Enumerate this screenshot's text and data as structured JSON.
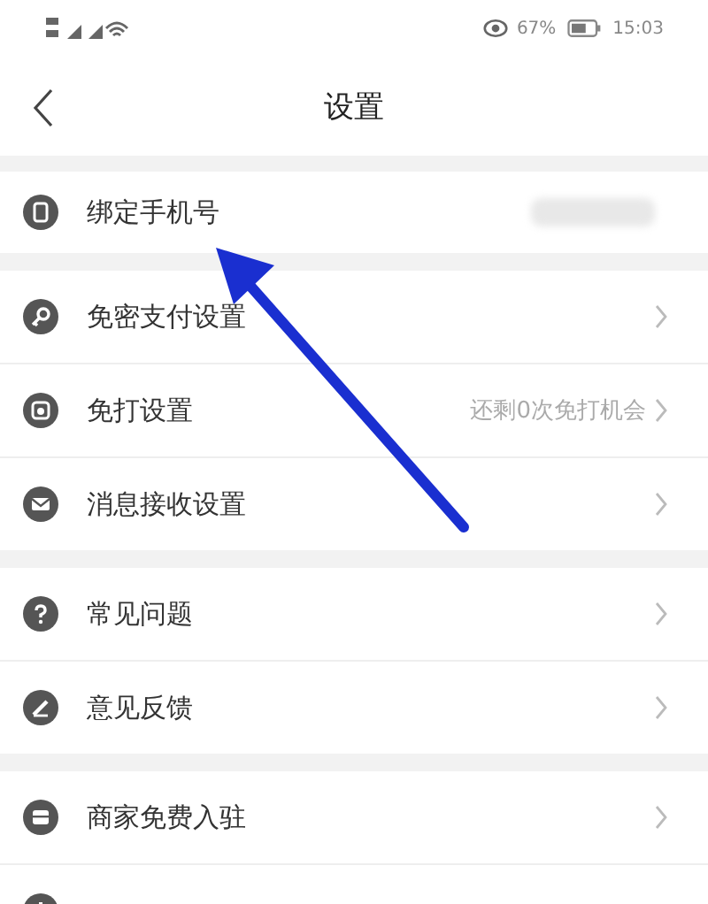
{
  "status_bar": {
    "battery_text": "67%",
    "time": "15:03"
  },
  "header": {
    "title": "设置"
  },
  "groups": [
    {
      "items": [
        {
          "label": "绑定手机号",
          "value_blurred": true,
          "chevron": false
        }
      ]
    },
    {
      "items": [
        {
          "label": "免密支付设置",
          "chevron": true
        },
        {
          "label": "免打设置",
          "value": "还剩0次免打机会",
          "chevron": true
        },
        {
          "label": "消息接收设置",
          "chevron": true
        }
      ]
    },
    {
      "items": [
        {
          "label": "常见问题",
          "chevron": true
        },
        {
          "label": "意见反馈",
          "chevron": true
        }
      ]
    },
    {
      "items": [
        {
          "label": "商家免费入驻",
          "chevron": true
        },
        {
          "chevron": false
        }
      ]
    }
  ]
}
